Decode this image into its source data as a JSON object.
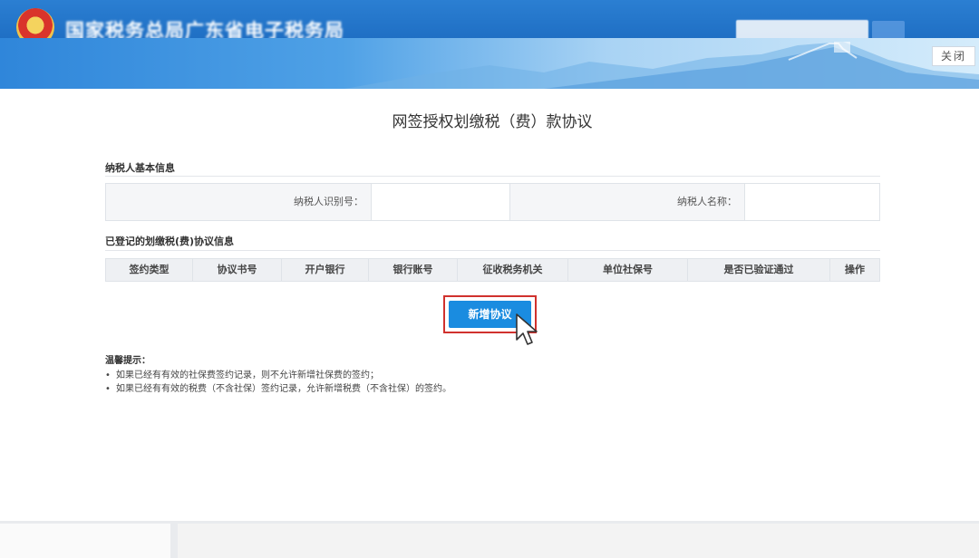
{
  "header": {
    "site_title": "国家税务总局广东省电子税务局",
    "close_label": "关闭"
  },
  "page": {
    "title": "网签授权划缴税（费）款协议"
  },
  "basic_info": {
    "section_title": "纳税人基本信息",
    "taxpayer_id_label": "纳税人识别号：",
    "taxpayer_id_value": "",
    "taxpayer_name_label": "纳税人名称：",
    "taxpayer_name_value": ""
  },
  "agreements": {
    "section_title": "已登记的划缴税(费)协议信息",
    "columns": [
      "签约类型",
      "协议书号",
      "开户银行",
      "银行账号",
      "征收税务机关",
      "单位社保号",
      "是否已验证通过",
      "操作"
    ],
    "rows": []
  },
  "actions": {
    "add_label": "新增协议"
  },
  "tips": {
    "title": "温馨提示：",
    "items": [
      "如果已经有有效的社保费签约记录，则不允许新增社保费的签约；",
      "如果已经有有效的税费（不含社保）签约记录，允许新增税费（不含社保）的签约。"
    ]
  },
  "colors": {
    "header_blue": "#1f6fc4",
    "primary_button": "#1a8ce0",
    "highlight_border": "#d0312d"
  }
}
